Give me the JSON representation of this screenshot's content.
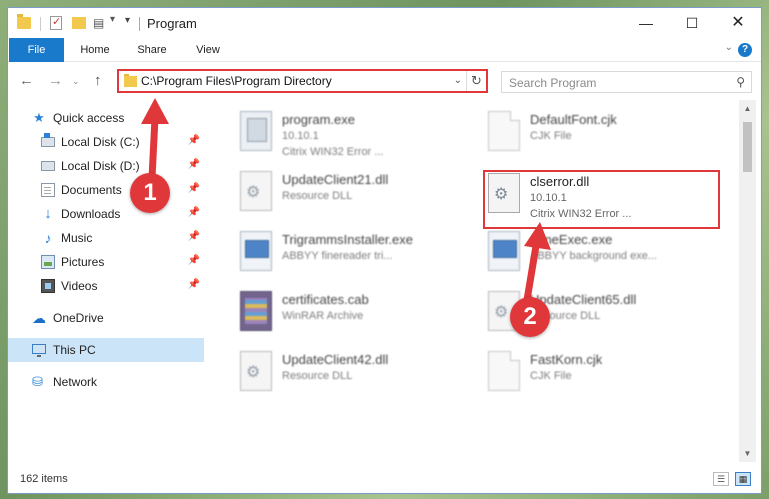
{
  "window": {
    "title": "Program",
    "controls": {
      "minimize": "—",
      "maximize": "☐",
      "close": "✕"
    }
  },
  "ribbon": {
    "tabs": [
      "File",
      "Home",
      "Share",
      "View"
    ],
    "expand": "⌄",
    "help": "?"
  },
  "nav": {
    "back": "←",
    "forward": "→",
    "recent": "⌄",
    "up": "↑",
    "address": "C:\\Program Files\\Program Directory",
    "address_dropdown": "⌄",
    "refresh": "↻",
    "search_placeholder": "Search Program",
    "search_icon": "⚲"
  },
  "sidebar": {
    "items": [
      {
        "label": "Quick access",
        "icon": "star-icon",
        "glyph": "★",
        "pinned": false
      },
      {
        "label": "Local Disk (C:)",
        "icon": "disk-icon",
        "pinned": true
      },
      {
        "label": "Local Disk (D:)",
        "icon": "disk-icon",
        "pinned": true
      },
      {
        "label": "Documents",
        "icon": "documents-icon",
        "pinned": true
      },
      {
        "label": "Downloads",
        "icon": "downloads-icon",
        "glyph": "↓",
        "pinned": true
      },
      {
        "label": "Music",
        "icon": "music-icon",
        "glyph": "♪",
        "pinned": true
      },
      {
        "label": "Pictures",
        "icon": "pictures-icon",
        "pinned": true
      },
      {
        "label": "Videos",
        "icon": "videos-icon",
        "pinned": true
      },
      {
        "label": "OneDrive",
        "icon": "cloud-icon",
        "glyph": "☁"
      },
      {
        "label": "This PC",
        "icon": "pc-icon",
        "selected": true
      },
      {
        "label": "Network",
        "icon": "network-icon",
        "glyph": "⛁"
      }
    ],
    "pin_glyph": "📌"
  },
  "files": [
    {
      "name": "program.exe",
      "line2": "10.10.1",
      "line3": "Citrix WIN32 Error ...",
      "icon": "exe-setup"
    },
    {
      "name": "DefaultFont.cjk",
      "line2": "CJK File",
      "line3": "",
      "icon": "doc"
    },
    {
      "name": "UpdateClient21.dll",
      "line2": "Resource DLL",
      "line3": "",
      "icon": "dll"
    },
    {
      "name": "clserror.dll",
      "line2": "10.10.1",
      "line3": "Citrix WIN32 Error ...",
      "icon": "dll",
      "highlighted": true
    },
    {
      "name": "TrigrammsInstaller.exe",
      "line2": "ABBYY finereader tri...",
      "line3": "",
      "icon": "exe"
    },
    {
      "name": "...meExec.exe",
      "line2": "ABBYY background exe...",
      "line3": "",
      "icon": "exe"
    },
    {
      "name": "certificates.cab",
      "line2": "WinRAR Archive",
      "line3": "",
      "icon": "rar"
    },
    {
      "name": "UpdateClient65.dll",
      "line2": "Resource DLL",
      "line3": "",
      "icon": "dll"
    },
    {
      "name": "UpdateClient42.dll",
      "line2": "Resource DLL",
      "line3": "",
      "icon": "dll"
    },
    {
      "name": "FastKorn.cjk",
      "line2": "CJK File",
      "line3": "",
      "icon": "doc"
    }
  ],
  "scrollbar": {
    "up": "▲",
    "down": "▼"
  },
  "status": {
    "item_count": "162 items",
    "view_details": "☰",
    "view_tiles": "▦"
  },
  "annotations": {
    "callout_1": "1",
    "callout_2": "2",
    "color": "#e0383a"
  }
}
